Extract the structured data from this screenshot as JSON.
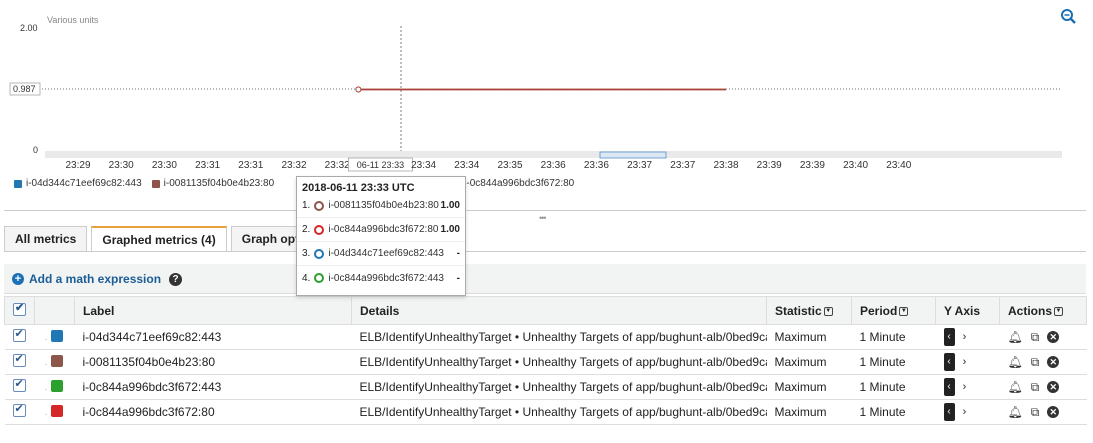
{
  "chart": {
    "unit_label": "Various units",
    "y_ticks": [
      "2.00",
      "0.987",
      "0"
    ],
    "x_ticks": [
      "23:29",
      "23:30",
      "23:30",
      "23:31",
      "23:31",
      "23:32",
      "23:32",
      "06-11 23:33",
      "23:34",
      "23:34",
      "23:35",
      "23:36",
      "23:36",
      "23:37",
      "23:37",
      "23:38",
      "23:39",
      "23:39",
      "23:40",
      "23:40"
    ],
    "hover_label": "06-11 23:33",
    "series_color": "#a9433a"
  },
  "chart_data": {
    "type": "line",
    "title": "",
    "ylabel": "Various units",
    "ylim": [
      0,
      2.0
    ],
    "y_marker": 0.987,
    "categories": [
      "23:29",
      "23:30",
      "23:30",
      "23:31",
      "23:31",
      "23:32",
      "23:32",
      "23:33",
      "23:34",
      "23:34",
      "23:35",
      "23:36",
      "23:36",
      "23:37",
      "23:37",
      "23:38",
      "23:39",
      "23:39",
      "23:40",
      "23:40"
    ],
    "series": [
      {
        "name": "i-04d344c71eef69c82:443",
        "color": "#1f77b4",
        "values": []
      },
      {
        "name": "i-0081135f04b0e4b23:80",
        "color": "#8c564b",
        "values": [
          null,
          null,
          null,
          null,
          null,
          null,
          null,
          1.0,
          1.0,
          1.0,
          1.0,
          1.0,
          1.0,
          1.0,
          1.0,
          1.0,
          null,
          null,
          null,
          null
        ]
      },
      {
        "name": "i-0c844a996bdc3f672:443",
        "color": "#2ca02c",
        "values": []
      },
      {
        "name": "i-0c844a996bdc3f672:80",
        "color": "#d62728",
        "values": [
          null,
          null,
          null,
          null,
          null,
          null,
          null,
          1.0,
          1.0,
          1.0,
          1.0,
          1.0,
          1.0,
          1.0,
          1.0,
          1.0,
          null,
          null,
          null,
          null
        ]
      }
    ]
  },
  "legend": [
    {
      "label": "i-04d344c71eef69c82:443",
      "color": "#1f77b4"
    },
    {
      "label": "i-0081135f04b0e4b23:80",
      "color": "#8c564b"
    },
    {
      "label": "i-0c844a996bdc3f672:80",
      "color": "#2ca02c"
    }
  ],
  "tooltip": {
    "title": "2018-06-11 23:33 UTC",
    "rows": [
      {
        "num": "1.",
        "label": "i-0081135f04b0e4b23:80",
        "value": "1.00",
        "color": "#8c564b"
      },
      {
        "num": "2.",
        "label": "i-0c844a996bdc3f672:80",
        "value": "1.00",
        "color": "#d62728"
      },
      {
        "num": "3.",
        "label": "i-04d344c71eef69c82:443",
        "value": "-",
        "color": "#1f77b4"
      },
      {
        "num": "4.",
        "label": "i-0c844a996bdc3f672:443",
        "value": "-",
        "color": "#2ca02c"
      }
    ]
  },
  "tabs": [
    {
      "label": "All metrics",
      "active": false
    },
    {
      "label": "Graphed metrics (4)",
      "active": true
    },
    {
      "label": "Graph optic",
      "active": false
    }
  ],
  "toolbar": {
    "add_math_label": "Add a math expression"
  },
  "table": {
    "headers": {
      "label": "Label",
      "details": "Details",
      "statistic": "Statistic",
      "period": "Period",
      "yaxis": "Y Axis",
      "actions": "Actions"
    },
    "rows": [
      {
        "label": "i-04d344c71eef69c82:443",
        "color": "#1f77b4",
        "details": "ELB/IdentifyUnhealthyTarget • Unhealthy Targets of app/bughunt-alb/0bed9ca...",
        "statistic": "Maximum",
        "period": "1 Minute"
      },
      {
        "label": "i-0081135f04b0e4b23:80",
        "color": "#8c564b",
        "details": "ELB/IdentifyUnhealthyTarget • Unhealthy Targets of app/bughunt-alb/0bed9ca...",
        "statistic": "Maximum",
        "period": "1 Minute"
      },
      {
        "label": "i-0c844a996bdc3f672:443",
        "color": "#2ca02c",
        "details": "ELB/IdentifyUnhealthyTarget • Unhealthy Targets of app/bughunt-alb/0bed9ca...",
        "statistic": "Maximum",
        "period": "1 Minute"
      },
      {
        "label": "i-0c844a996bdc3f672:80",
        "color": "#d62728",
        "details": "ELB/IdentifyUnhealthyTarget • Unhealthy Targets of app/bughunt-alb/0bed9ca...",
        "statistic": "Maximum",
        "period": "1 Minute"
      }
    ]
  }
}
